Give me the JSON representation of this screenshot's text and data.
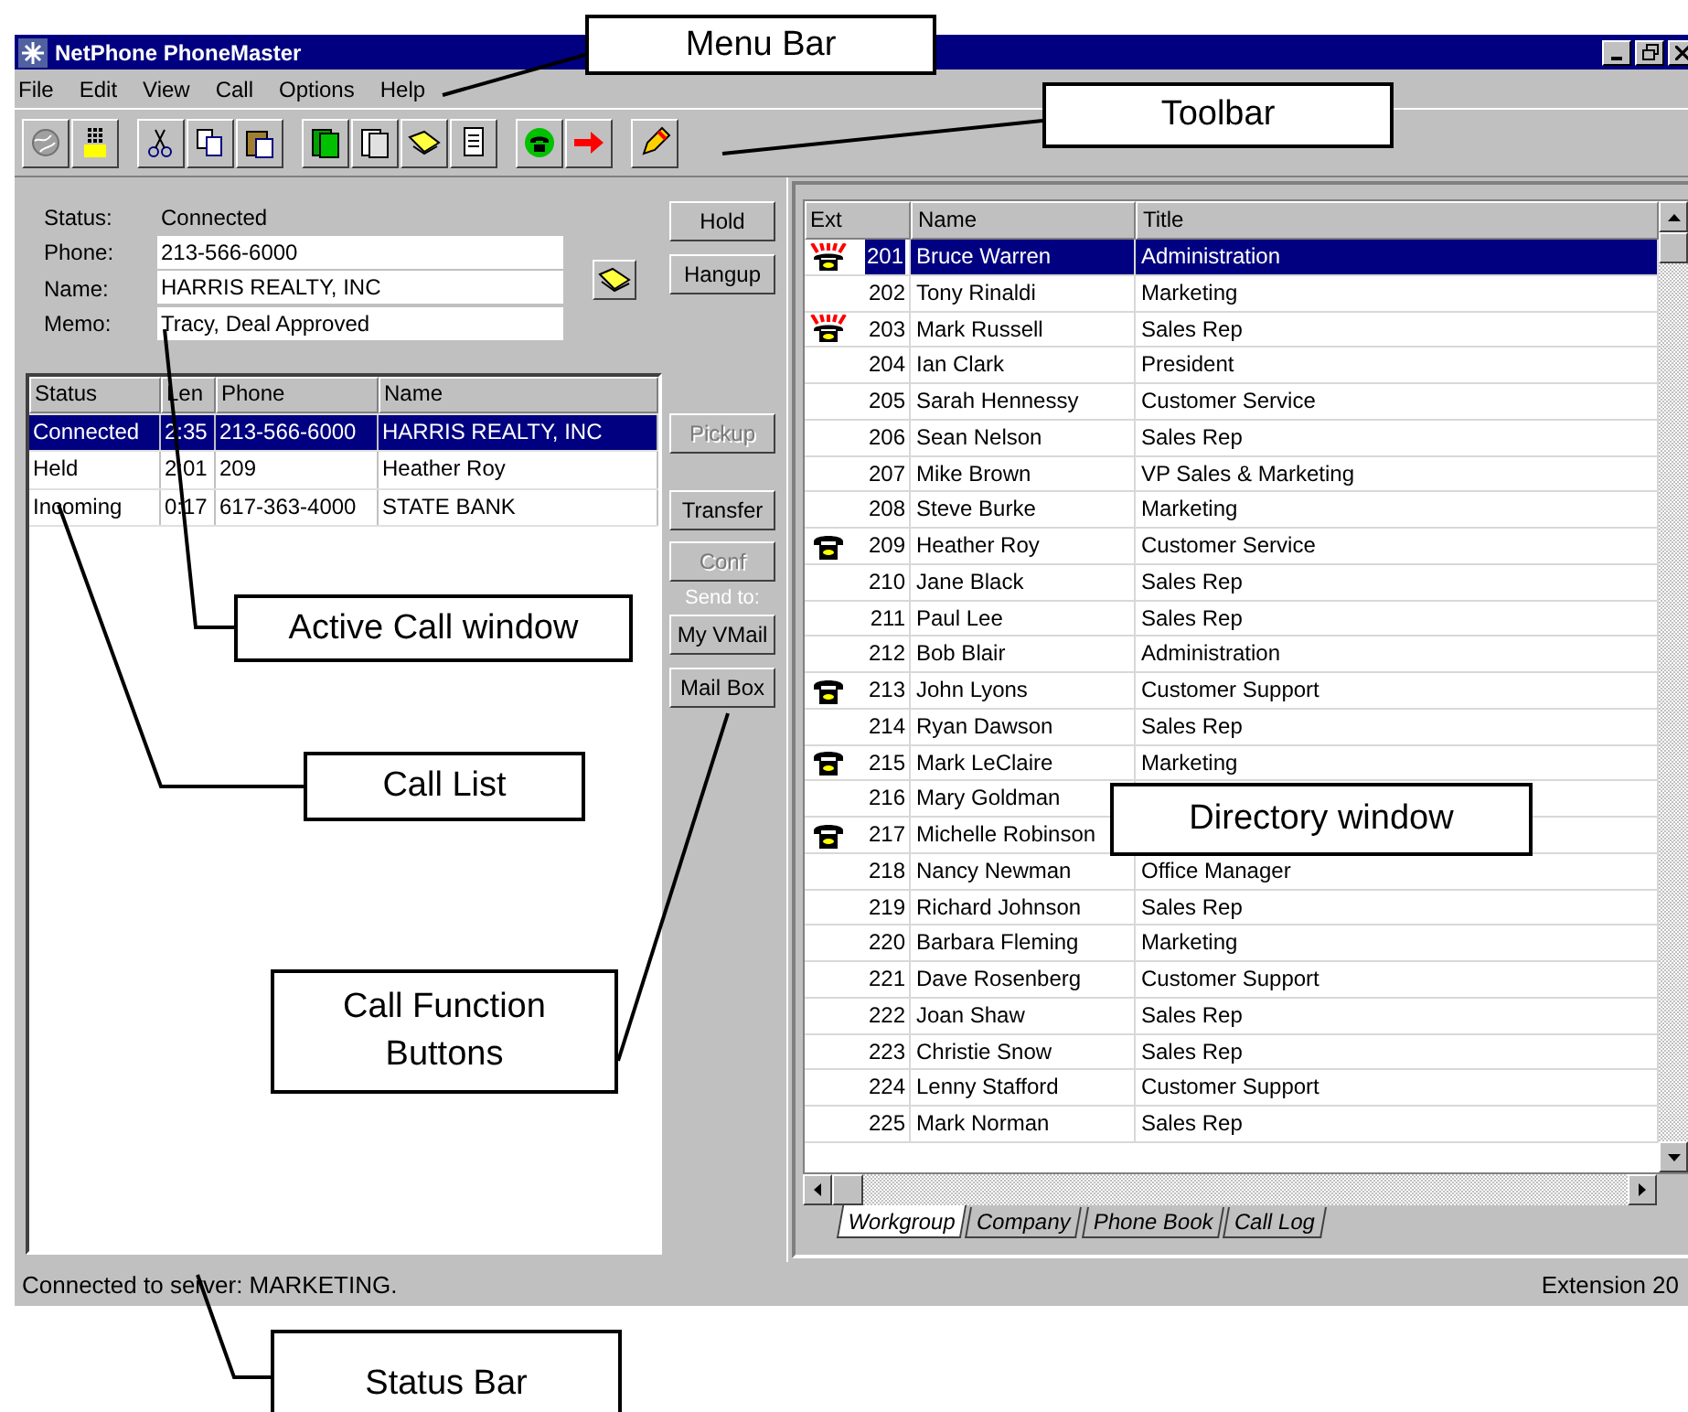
{
  "window": {
    "title": "NetPhone PhoneMaster"
  },
  "menu": [
    "File",
    "Edit",
    "View",
    "Call",
    "Options",
    "Help"
  ],
  "active_call": {
    "fields": [
      {
        "label": "Status:",
        "value": "Connected",
        "kind": "text"
      },
      {
        "label": "Phone:",
        "value": "213-566-6000",
        "kind": "input"
      },
      {
        "label": "Name:",
        "value": "HARRIS REALTY, INC",
        "kind": "input"
      },
      {
        "label": "Memo:",
        "value": "Tracy, Deal Approved",
        "kind": "input"
      }
    ]
  },
  "call_list": {
    "columns": [
      "Status",
      "Len",
      "Phone",
      "Name"
    ],
    "rows": [
      {
        "cells": [
          "Connected",
          "2:35",
          "213-566-6000",
          "HARRIS REALTY, INC"
        ],
        "selected": true
      },
      {
        "cells": [
          "Held",
          "2:01",
          "209",
          "Heather Roy"
        ],
        "selected": false
      },
      {
        "cells": [
          "Incoming",
          "0:17",
          "617-363-4000",
          "STATE BANK"
        ],
        "selected": false
      }
    ]
  },
  "call_buttons": [
    {
      "label": "Hold",
      "disabled": false,
      "kind": "button"
    },
    {
      "label": "Hangup",
      "disabled": false,
      "kind": "button"
    },
    {
      "label": "Pickup",
      "disabled": true,
      "kind": "button"
    },
    {
      "label": "Transfer",
      "disabled": false,
      "kind": "button"
    },
    {
      "label": "Conf",
      "disabled": true,
      "kind": "button"
    },
    {
      "label": "Send to:",
      "kind": "label"
    },
    {
      "label": "My VMail",
      "disabled": false,
      "kind": "button"
    },
    {
      "label": "Mail Box",
      "disabled": false,
      "kind": "button"
    }
  ],
  "directory": {
    "columns": [
      "Ext",
      "Name",
      "Title"
    ],
    "rows": [
      {
        "ext": "201",
        "name": "Bruce Warren",
        "title": "Administration",
        "kind": "ringing",
        "selected": true
      },
      {
        "ext": "202",
        "name": "Tony Rinaldi",
        "title": "Marketing",
        "kind": "idle",
        "selected": false
      },
      {
        "ext": "203",
        "name": "Mark Russell",
        "title": "Sales Rep",
        "kind": "ringing",
        "selected": false
      },
      {
        "ext": "204",
        "name": "Ian Clark",
        "title": "President",
        "kind": "idle",
        "selected": false
      },
      {
        "ext": "205",
        "name": "Sarah Hennessy",
        "title": "Customer Service",
        "kind": "idle",
        "selected": false
      },
      {
        "ext": "206",
        "name": "Sean Nelson",
        "title": "Sales Rep",
        "kind": "idle",
        "selected": false
      },
      {
        "ext": "207",
        "name": "Mike Brown",
        "title": "VP Sales & Marketing",
        "kind": "idle",
        "selected": false
      },
      {
        "ext": "208",
        "name": "Steve Burke",
        "title": "Marketing",
        "kind": "idle",
        "selected": false
      },
      {
        "ext": "209",
        "name": "Heather Roy",
        "title": "Customer Service",
        "kind": "in_use",
        "selected": false
      },
      {
        "ext": "210",
        "name": "Jane Black",
        "title": "Sales Rep",
        "kind": "idle",
        "selected": false
      },
      {
        "ext": "211",
        "name": "Paul Lee",
        "title": "Sales Rep",
        "kind": "idle",
        "selected": false
      },
      {
        "ext": "212",
        "name": "Bob Blair",
        "title": "Administration",
        "kind": "idle",
        "selected": false
      },
      {
        "ext": "213",
        "name": "John Lyons",
        "title": "Customer Support",
        "kind": "in_use",
        "selected": false
      },
      {
        "ext": "214",
        "name": "Ryan Dawson",
        "title": "Sales Rep",
        "kind": "idle",
        "selected": false
      },
      {
        "ext": "215",
        "name": "Mark LeClaire",
        "title": "Marketing",
        "kind": "in_use",
        "selected": false
      },
      {
        "ext": "216",
        "name": "Mary Goldman",
        "kind": "idle",
        "selected": false
      },
      {
        "ext": "217",
        "name": "Michelle Robinson",
        "kind": "in_use",
        "selected": false
      },
      {
        "ext": "218",
        "name": "Nancy Newman",
        "title": "Office Manager",
        "kind": "idle",
        "selected": false
      },
      {
        "ext": "219",
        "name": "Richard Johnson",
        "title": "Sales Rep",
        "kind": "idle",
        "selected": false
      },
      {
        "ext": "220",
        "name": "Barbara Fleming",
        "title": "Marketing",
        "kind": "idle",
        "selected": false
      },
      {
        "ext": "221",
        "name": "Dave Rosenberg",
        "title": "Customer Support",
        "kind": "idle",
        "selected": false
      },
      {
        "ext": "222",
        "name": "Joan Shaw",
        "title": "Sales Rep",
        "kind": "idle",
        "selected": false
      },
      {
        "ext": "223",
        "name": "Christie Snow",
        "title": "Sales Rep",
        "kind": "idle",
        "selected": false
      },
      {
        "ext": "224",
        "name": "Lenny Stafford",
        "title": "Customer Support",
        "kind": "idle",
        "selected": false
      },
      {
        "ext": "225",
        "name": "Mark Norman",
        "title": "Sales Rep",
        "kind": "idle",
        "selected": false
      }
    ],
    "tabs": [
      {
        "label": "Workgroup",
        "selected": true
      },
      {
        "label": "Company",
        "selected": false
      },
      {
        "label": "Phone Book",
        "selected": false
      },
      {
        "label": "Call Log",
        "selected": false
      }
    ]
  },
  "status_bar": {
    "message": "Connected to server: MARKETING.",
    "extension": "Extension 20"
  },
  "callouts": [
    "Menu Bar",
    "Toolbar",
    "Active Call window",
    "Call List",
    "Call Function Buttons",
    "Directory window",
    "Status Bar"
  ]
}
